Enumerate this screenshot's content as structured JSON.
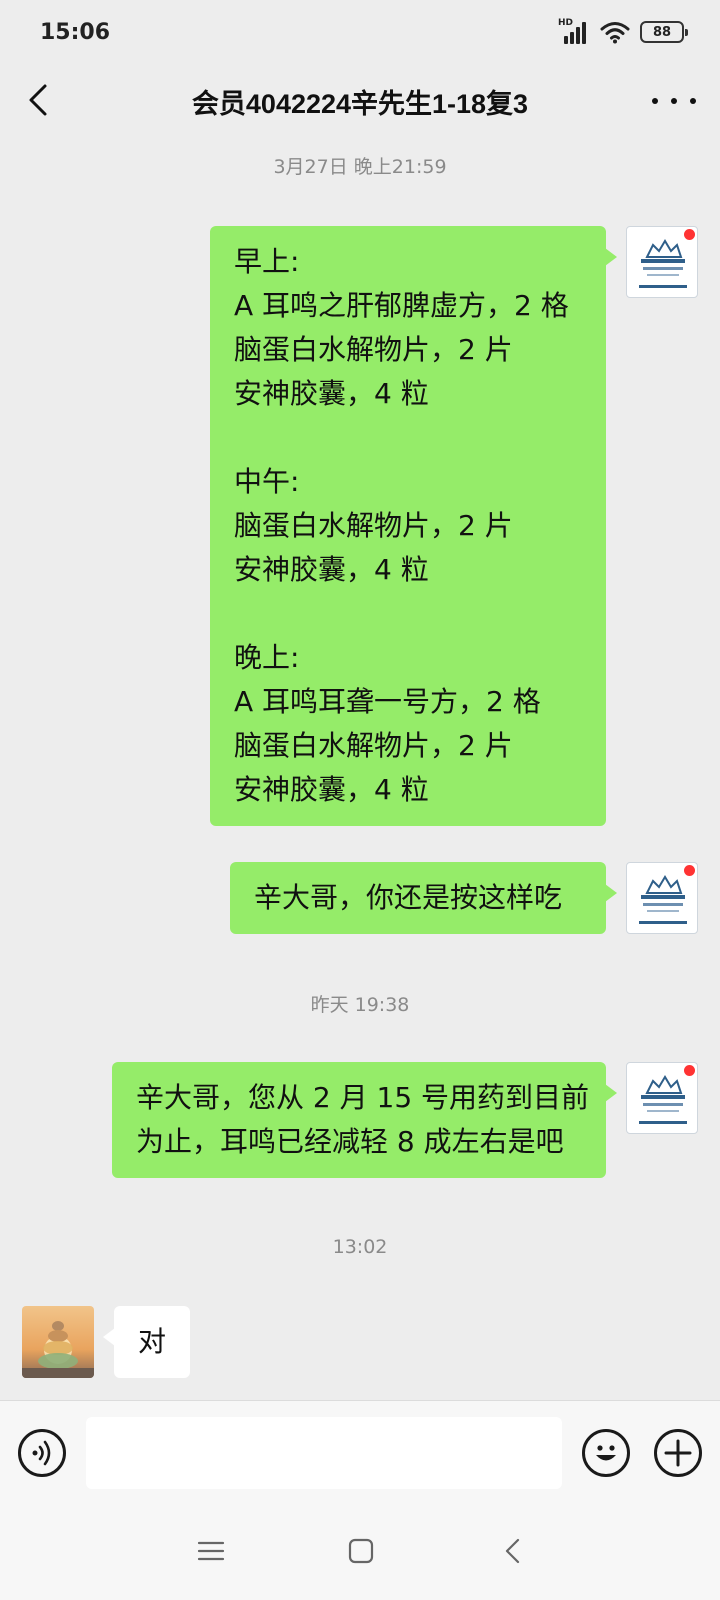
{
  "status_bar": {
    "time": "15:06",
    "network_label": "HD",
    "battery": "88"
  },
  "header": {
    "title": "会员4042224辛先生1-18复3",
    "back_icon": "chevron-left-icon",
    "more_icon": "more-dots-icon"
  },
  "messages": [
    {
      "type": "timestamp",
      "text": "3月27日 晚上21:59"
    },
    {
      "type": "outgoing",
      "lines": [
        "早上:",
        "A 耳鸣之肝郁脾虚方，2 格",
        "脑蛋白水解物片，2 片",
        "安神胶囊，4 粒",
        "",
        "中午:",
        "脑蛋白水解物片，2 片",
        "安神胶囊，4 粒",
        "",
        "晚上:",
        "A 耳鸣耳聋一号方，2 格",
        "脑蛋白水解物片，2 片",
        "安神胶囊，4 粒"
      ]
    },
    {
      "type": "outgoing",
      "lines": [
        "辛大哥，你还是按这样吃"
      ]
    },
    {
      "type": "timestamp",
      "text": "昨天 19:38"
    },
    {
      "type": "outgoing",
      "lines": [
        "辛大哥，您从 2 月 15 号用药到目前",
        "为止，耳鸣已经减轻 8 成左右是吧"
      ]
    },
    {
      "type": "timestamp",
      "text": "13:02"
    },
    {
      "type": "incoming",
      "lines": [
        "对"
      ]
    }
  ],
  "input_bar": {
    "voice_icon": "voice-icon",
    "emoji_icon": "emoji-icon",
    "plus_icon": "plus-icon",
    "placeholder": ""
  },
  "system_nav": {
    "menu_icon": "menu-icon",
    "home_icon": "home-square-icon",
    "back_icon": "back-triangle-icon"
  },
  "colors": {
    "background": "#ededed",
    "outgoing_bubble": "#95ec69",
    "incoming_bubble": "#ffffff",
    "timestamp_text": "#8a8a8a",
    "unread_dot": "#ff3333"
  }
}
